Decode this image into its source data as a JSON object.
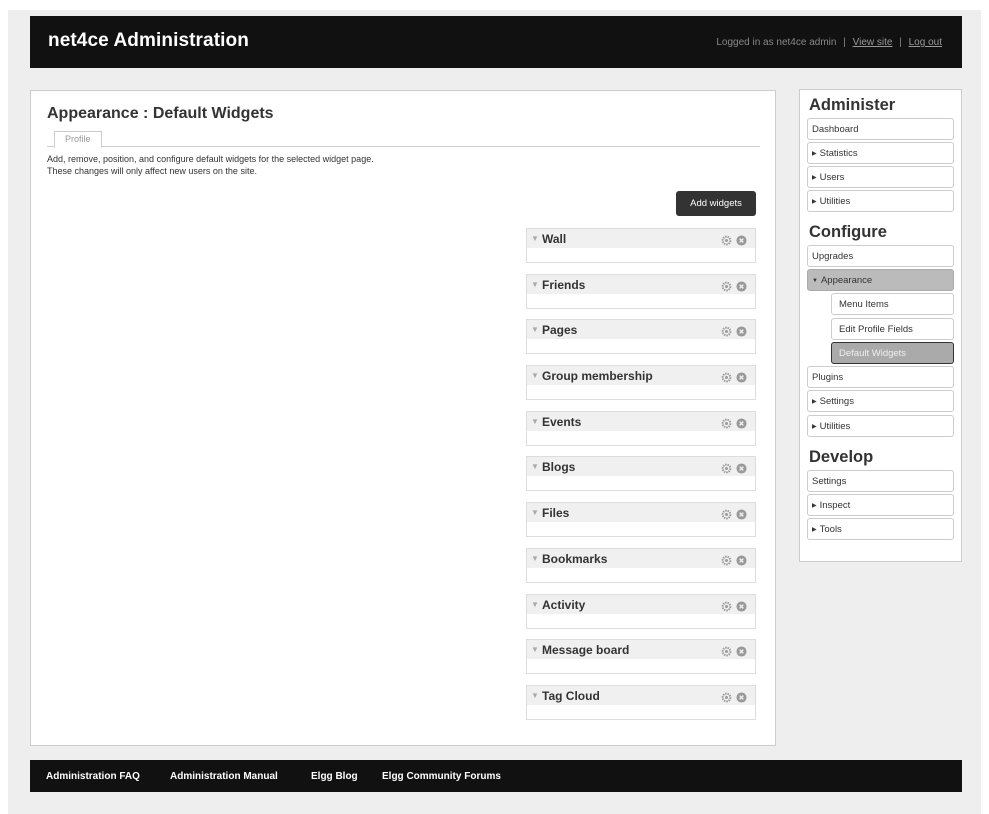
{
  "header": {
    "title": "net4ce Administration",
    "logged_in_text": "Logged in as net4ce admin",
    "separator": "|",
    "view_site": "View site",
    "log_out": "Log out"
  },
  "main": {
    "page_title": "Appearance : Default Widgets",
    "tab": "Profile",
    "desc_line1": "Add, remove, position, and configure default widgets for the selected widget page.",
    "desc_line2": "These changes will only affect new users on the site.",
    "add_widgets": "Add widgets",
    "widgets": [
      "Wall",
      "Friends",
      "Pages",
      "Group membership",
      "Events",
      "Blogs",
      "Files",
      "Bookmarks",
      "Activity",
      "Message board",
      "Tag Cloud"
    ]
  },
  "sidebar": {
    "administer": "Administer",
    "dashboard": "Dashboard",
    "statistics": "Statistics",
    "users": "Users",
    "utilities": "Utilities",
    "configure": "Configure",
    "upgrades": "Upgrades",
    "appearance": "Appearance",
    "menu_items": "Menu Items",
    "edit_profile_fields": "Edit Profile Fields",
    "default_widgets": "Default Widgets",
    "plugins": "Plugins",
    "settings": "Settings",
    "utilities2": "Utilities",
    "develop": "Develop",
    "dev_settings": "Settings",
    "inspect": "Inspect",
    "tools": "Tools"
  },
  "footer": {
    "links": [
      "Administration FAQ",
      "Administration Manual",
      "Elgg Blog",
      "Elgg Community Forums"
    ]
  },
  "icons": {
    "widget_toggle": "triangle-down-icon",
    "widget_settings": "gear-icon",
    "widget_delete": "close-circle-icon",
    "menu_caret": "triangle-right-icon"
  }
}
